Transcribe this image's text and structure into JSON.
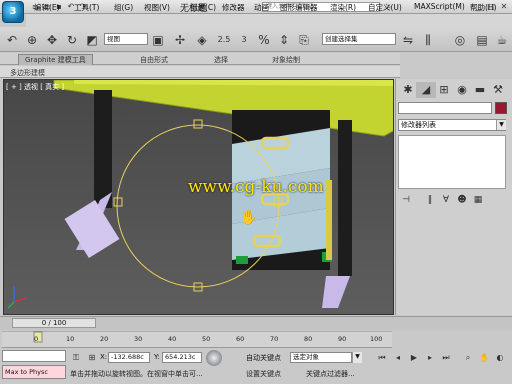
{
  "title_bar": {
    "app_logo": "3",
    "title": "无标题",
    "search_placeholder": "键入关键字或短语",
    "quick_access_icons": [
      "new-file-icon",
      "open-folder-icon",
      "save-icon",
      "undo-icon",
      "redo-icon"
    ],
    "window_controls": [
      "minimize-icon",
      "maximize-icon",
      "close-icon"
    ]
  },
  "menu": [
    "编辑(E)",
    "工具(T)",
    "组(G)",
    "视图(V)",
    "创建(C)",
    "修改器",
    "动画",
    "图形编辑器",
    "渲染(R)",
    "自定义(U)",
    "MAXScript(M)",
    "帮助(H)"
  ],
  "toolbar": {
    "view_select": "视图",
    "selection_set": "创建选择集",
    "snap_value": "2.5",
    "angle_value": "3"
  },
  "ribbon": {
    "tabs": [
      "Graphite 建模工具",
      "自由形式",
      "选择",
      "对象绘制"
    ],
    "active_tab": "Graphite 建模工具",
    "sub_label": "多边形建模"
  },
  "viewport": {
    "label": "[ + ] 透视 [ 真实 ]",
    "watermark": "www.cg-ku.com"
  },
  "command_panel": {
    "tabs": [
      "create-icon",
      "modify-icon",
      "hierarchy-icon",
      "motion-icon",
      "display-icon",
      "utilities-icon"
    ],
    "modifier_list": "修改器列表",
    "color": "#9a1730"
  },
  "timeline": {
    "frame_counter": "0 / 100",
    "ticks": [
      "0",
      "10",
      "20",
      "30",
      "40",
      "50",
      "60",
      "70",
      "80",
      "90",
      "100"
    ]
  },
  "status": {
    "maxscript_label": "Max to Physc",
    "x_label": "X:",
    "x_value": "-132.688c",
    "y_label": "Y:",
    "y_value": "654.213c",
    "auto_key": "自动关键点",
    "selected_object": "选定对象",
    "set_key": "设置关键点",
    "key_filters": "关键点过滤器...",
    "prompt": "单击并拖动以旋转视图。在视窗中单击可..."
  }
}
